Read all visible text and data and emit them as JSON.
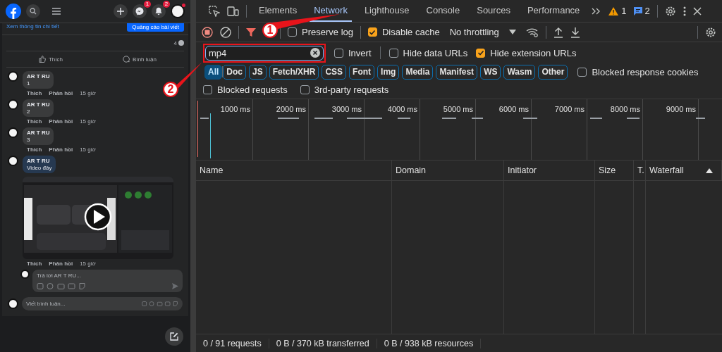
{
  "facebook": {
    "top_bar": {
      "notifications": [
        {
          "kind": "messenger",
          "badge": "1"
        },
        {
          "kind": "bell",
          "badge": "2"
        }
      ]
    },
    "post": {
      "details_link": "Xem thông tin chi tiết",
      "boost_button": "Quảng cáo bài viết",
      "comment_count": "4",
      "actions": [
        "Thích",
        "Bình luận"
      ]
    },
    "comments": [
      {
        "author": "AR T RU",
        "text": "1",
        "highlighted": false,
        "actions": [
          "Thích",
          "Phản hồi"
        ],
        "time": "15 giờ"
      },
      {
        "author": "AR T RU",
        "text": "2",
        "highlighted": false,
        "actions": [
          "Thích",
          "Phản hồi"
        ],
        "time": "15 giờ"
      },
      {
        "author": "AR T RU",
        "text": "3",
        "highlighted": false,
        "actions": [
          "Thích",
          "Phản hồi"
        ],
        "time": "15 giờ"
      },
      {
        "author": "AR T RU",
        "text": "Video đây",
        "highlighted": true,
        "video": {
          "kind": "picture"
        },
        "actions": [
          "Thích",
          "Phản hồi"
        ],
        "time": "15 giờ"
      }
    ],
    "reply_box": {
      "placeholder": "Trả lời AR T RU..."
    },
    "comment_box": {
      "placeholder": "Viết bình luận..."
    }
  },
  "devtools": {
    "tabs": [
      {
        "label": "Elements",
        "selected": false
      },
      {
        "label": "Network",
        "selected": true
      },
      {
        "label": "Lighthouse",
        "selected": false
      },
      {
        "label": "Console",
        "selected": false
      },
      {
        "label": "Sources",
        "selected": false
      },
      {
        "label": "Performance",
        "selected": false
      }
    ],
    "issues": {
      "warnings": "1",
      "messages": "2"
    },
    "toolbar": {
      "options": [
        {
          "label": "Preserve log",
          "checked": false
        },
        {
          "label": "Disable cache",
          "checked": true
        }
      ],
      "throttling": "No throttling"
    },
    "filter": {
      "value": "mp4",
      "options": [
        {
          "label": "Invert",
          "checked": false
        },
        {
          "label": "Hide data URLs",
          "checked": false
        },
        {
          "label": "Hide extension URLs",
          "checked": true
        }
      ]
    },
    "type_filters": [
      {
        "label": "All",
        "selected": true
      },
      {
        "label": "Doc",
        "selected": false
      },
      {
        "label": "JS",
        "selected": false
      },
      {
        "label": "Fetch/XHR",
        "selected": false
      },
      {
        "label": "CSS",
        "selected": false
      },
      {
        "label": "Font",
        "selected": false
      },
      {
        "label": "Img",
        "selected": false
      },
      {
        "label": "Media",
        "selected": false
      },
      {
        "label": "Manifest",
        "selected": false
      },
      {
        "label": "WS",
        "selected": false
      },
      {
        "label": "Wasm",
        "selected": false
      },
      {
        "label": "Other",
        "selected": false
      }
    ],
    "cookie_option": {
      "label": "Blocked response cookies",
      "checked": false
    },
    "request_options": [
      {
        "label": "Blocked requests",
        "checked": false
      },
      {
        "label": "3rd-party requests",
        "checked": false
      }
    ],
    "overview": {
      "ticks": [
        "1000 ms",
        "2000 ms",
        "3000 ms",
        "4000 ms",
        "5000 ms",
        "6000 ms",
        "7000 ms",
        "8000 ms",
        "9000 ms"
      ]
    },
    "table": {
      "columns": [
        {
          "label": "Name",
          "sorted": false
        },
        {
          "label": "Domain",
          "sorted": false
        },
        {
          "label": "Initiator",
          "sorted": false
        },
        {
          "label": "Size",
          "sorted": false
        },
        {
          "label": "T.",
          "sorted": false
        },
        {
          "label": "Waterfall",
          "sorted": true
        }
      ]
    },
    "status_bar": [
      "0 / 91 requests",
      "0 B / 370 kB transferred",
      "0 B / 938 kB resources"
    ]
  },
  "annotations": [
    {
      "number": "1"
    },
    {
      "number": "2"
    }
  ]
}
